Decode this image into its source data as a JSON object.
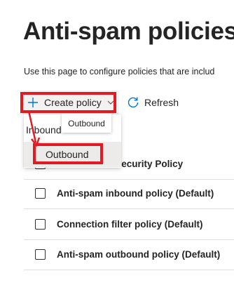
{
  "page": {
    "title": "Anti-spam policies",
    "description": "Use this page to configure policies that are includ"
  },
  "toolbar": {
    "create_label": "Create policy",
    "create_icon": "plus-icon",
    "create_chevron": "chevron-down-icon",
    "refresh_label": "Refresh",
    "refresh_icon": "refresh-icon"
  },
  "dropdown": {
    "items": [
      {
        "label": "Inbound"
      },
      {
        "label": "Outbound"
      }
    ],
    "tooltip": "Outbound"
  },
  "policies": {
    "rows": [
      {
        "label": "Strict Preset Security Policy"
      },
      {
        "label": "Anti-spam inbound policy (Default)"
      },
      {
        "label": "Connection filter policy (Default)"
      },
      {
        "label": "Anti-spam outbound policy (Default)"
      }
    ]
  },
  "colors": {
    "accent": "#0078d4",
    "annotation": "#e01b24",
    "hover": "#edebe9"
  }
}
